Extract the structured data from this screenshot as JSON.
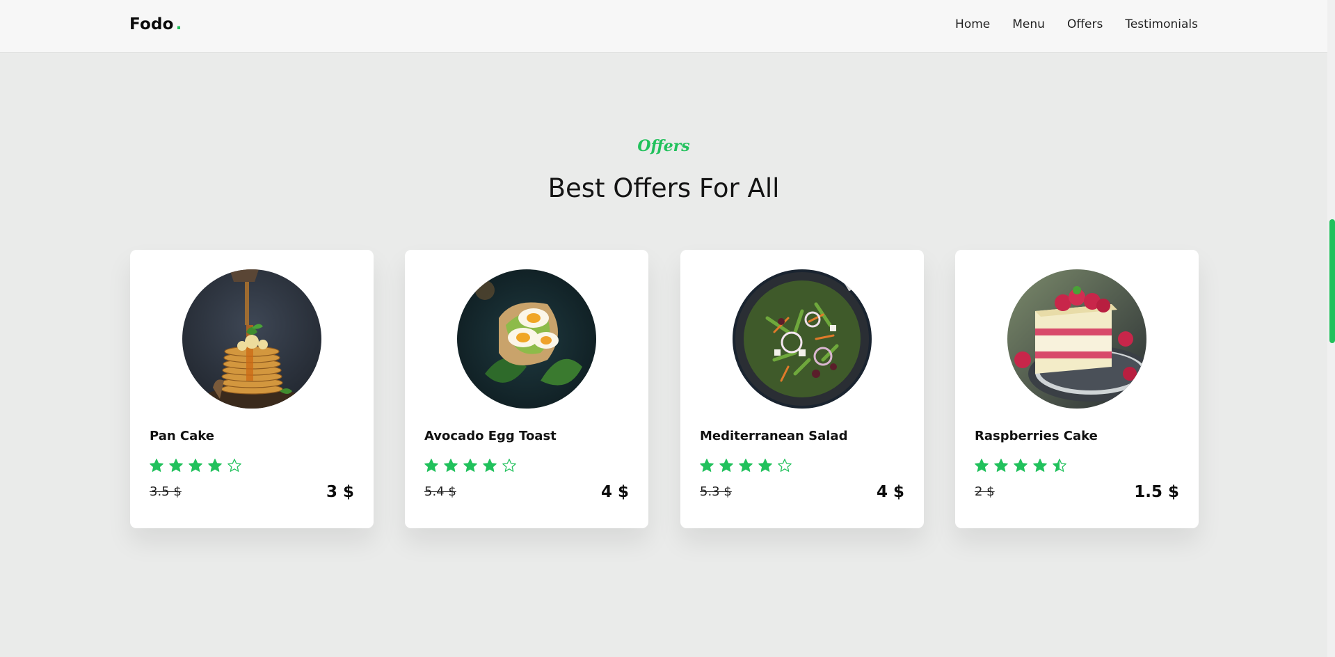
{
  "brand": {
    "name": "Fodo",
    "dot": ".",
    "accent": "#21c15c"
  },
  "nav": {
    "items": [
      "Home",
      "Menu",
      "Offers",
      "Testimonials"
    ]
  },
  "section": {
    "subtitle": "Offers",
    "title": "Best Offers For All"
  },
  "cards": [
    {
      "name": "Pan Cake",
      "rating": 4,
      "old_price": "3.5 $",
      "price": "3 $",
      "image": "pancake-stack-photo"
    },
    {
      "name": "Avocado Egg Toast",
      "rating": 4,
      "old_price": "5.4 $",
      "price": "4 $",
      "image": "avocado-egg-toast-photo"
    },
    {
      "name": "Mediterranean Salad",
      "rating": 4,
      "old_price": "5.3 $",
      "price": "4 $",
      "image": "mediterranean-salad-photo"
    },
    {
      "name": "Raspberries Cake",
      "rating": 4.5,
      "old_price": "2 $",
      "price": "1.5 $",
      "image": "raspberry-cake-photo"
    }
  ],
  "colors": {
    "star": "#21c15c",
    "background": "#eaebea",
    "card": "#ffffff"
  }
}
